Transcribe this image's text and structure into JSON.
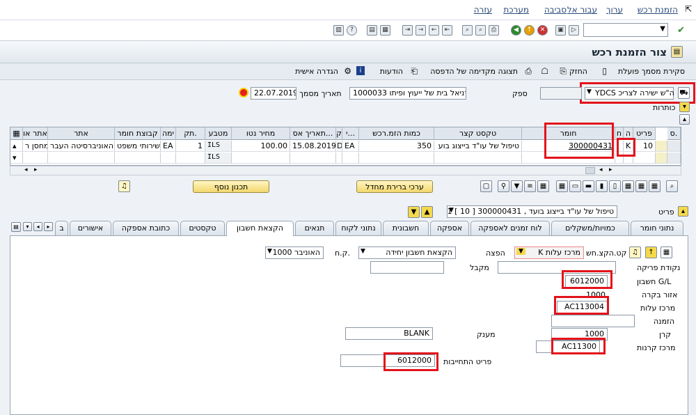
{
  "menu": [
    "הזמנת רכש",
    "ערוך",
    "עבור אל",
    "סביבה",
    "מערכת",
    "עזרה"
  ],
  "title": "צור הזמנת רכש",
  "appbar": {
    "personal_settings": "הגדרה אישית",
    "messages": "הודעות",
    "print_preview": "תצוגה מקדימה של הדפסה",
    "hold": "החזק",
    "doc_overview": "סקירת מסמך פועלת"
  },
  "header": {
    "po_type": "YDCS ה\"ש ישירה לצריכ",
    "vendor_label": "ספק",
    "vendor_value": "1000033 דניאל בית של ייעוץ ופיתו",
    "doc_date_label": "תאריך מסמך",
    "doc_date_value": "22.07.2019",
    "headers_label": "כותרות"
  },
  "grid": {
    "columns": [
      "ס.",
      "פריט",
      "ה",
      "ח",
      "חומר",
      "טקסט קצר",
      "כמות הזמ.רכש",
      "י...",
      "ק",
      "תאריך אס...",
      "מחיר נטו",
      "מטבע",
      "תק.",
      "ימה",
      "קבוצת חומר",
      "אתר",
      "אתר או"
    ],
    "rows": [
      {
        "item": "10",
        "acct": "K",
        "material": "300000431",
        "short_text": "טיפול של עו\"ד בייצוג בוע",
        "qty": "350",
        "unit": "EA",
        "cat": "D",
        "deliv_date": "15.08.2019",
        "net_price": "100.00",
        "currency": "ILS",
        "per": "1",
        "uom": "EA",
        "mat_group": "שירותי משפט",
        "plant": "האוניברסיטה העבר",
        "storage": "מחסן ר"
      },
      {
        "currency": "ILS"
      }
    ]
  },
  "buttons": {
    "defaults": "ערכי ברירת מחדל",
    "extra_planning": "תכנון נוסף"
  },
  "item_detail": {
    "label": "פריט",
    "selected": "1 [ 10 ] 300000431 , טיפול של עו\"ד בייצוג בועד"
  },
  "tabs": [
    "נתוני חומר",
    "כמויות/משקלים",
    "לוח זמנים לאספקה",
    "אספקה",
    "חשבונית",
    "נתוני לקוח",
    "תנאים",
    "הקצאת חשבון",
    "טקסטים",
    "כתובת אספקה",
    "אישורים",
    "ב"
  ],
  "account": {
    "acct_cat_label": "קט.הקצ.חש",
    "acct_cat_value": "K מרכז עלות",
    "distrib_label": "הפצה",
    "distrib_value": "הקצאת חשבון יחידה",
    "co_label": "ק.ח.",
    "co_value": "1000 האוניבר",
    "unload_label": "נקודת פריקה",
    "recipient_label": "מקבל",
    "gl_label": "חשבון G/L",
    "gl_value": "6012000",
    "area_label": "אזור בקרה",
    "area_value": "1000",
    "cc_label": "מרכז עלות",
    "cc_value": "AC113004",
    "order_label": "הזמנה",
    "fund_label": "קרן",
    "fund_value": "1000",
    "grantee_label": "מענק",
    "grantee_value": "BLANK",
    "fc_label": "מרכז קרנות",
    "fc_value": "AC11300",
    "commit_label": "פריט התחייבות",
    "commit_value": "6012000"
  }
}
